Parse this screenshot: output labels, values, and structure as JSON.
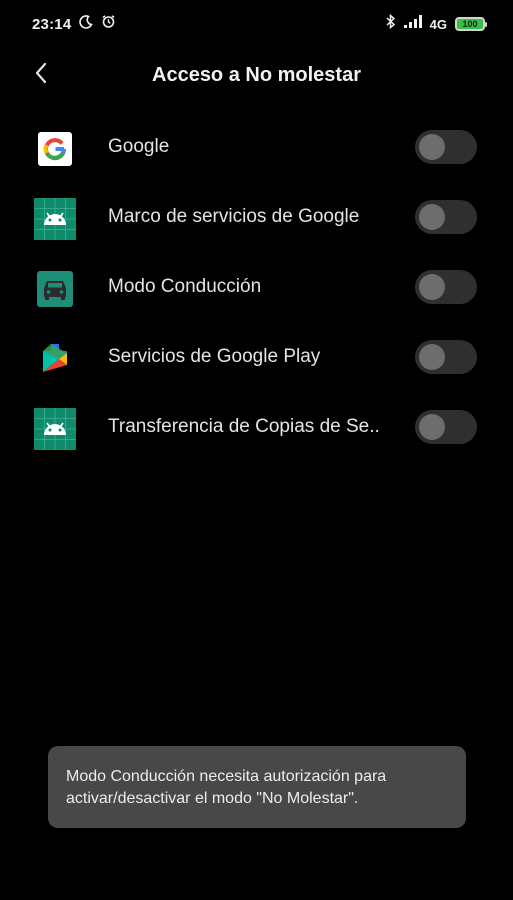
{
  "status_bar": {
    "time": "23:14",
    "network": "4G",
    "battery_label": "100",
    "icons": [
      "moon-icon",
      "alarm-icon",
      "bluetooth-icon",
      "signal-icon",
      "battery-icon"
    ]
  },
  "header": {
    "title": "Acceso a No molestar",
    "back_icon": "back-arrow-icon"
  },
  "apps": [
    {
      "label": "Google",
      "icon": "google-icon",
      "enabled": false
    },
    {
      "label": "Marco de servicios de Google",
      "icon": "android-icon",
      "enabled": false
    },
    {
      "label": "Modo Conducción",
      "icon": "car-icon",
      "enabled": false
    },
    {
      "label": "Servicios de Google Play",
      "icon": "play-services-icon",
      "enabled": false
    },
    {
      "label": "Transferencia de Copias de Se..",
      "icon": "android-icon",
      "enabled": false
    }
  ],
  "toast": {
    "message": "Modo Conducción necesita autorización para activar/desactivar el modo \"No Molestar\"."
  },
  "colors": {
    "background": "#000000",
    "toggle_track_off": "#2f2f2f",
    "toggle_knob_off": "#6d6d6d",
    "android_tile": "#0f8a6a",
    "battery_fill": "#3dbb4d"
  }
}
